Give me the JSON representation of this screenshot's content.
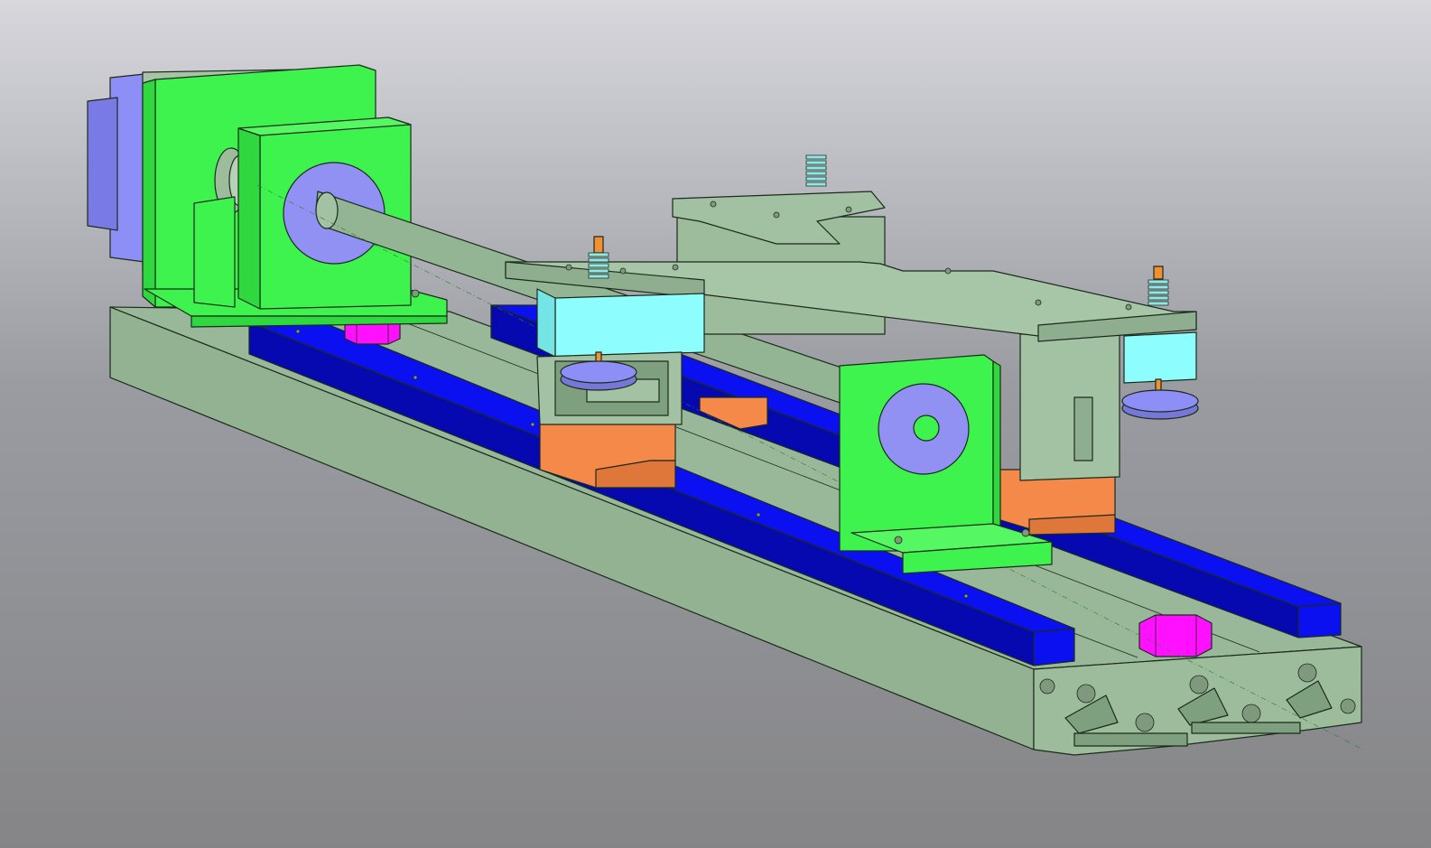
{
  "viewport": {
    "background_top": "#d7d7dc",
    "background_bottom": "#858587"
  },
  "colors": {
    "extrusion": "#99b899",
    "extrusion_dark": "#7fa07f",
    "motor_mount": "#3ff34f",
    "rail": "#0a10f0",
    "rail_dark": "#0609b0",
    "carriage_block": "#f5894a",
    "bearing_block": "#8efdfd",
    "hex_nut": "#ff10ff",
    "stepper_motor": "#8e8ef7",
    "bearing_face": "#9191f4",
    "spring": "#8fe7e7",
    "screw": "#f09030",
    "leadscrew": "#94b594",
    "outline": "#1b2a1b"
  },
  "parts": [
    "aluminum-extrusion",
    "linear-rail",
    "rail-carriage",
    "motor-mount",
    "stepper-motor",
    "bearing-block",
    "end-support",
    "leadscrew",
    "gantry-plate",
    "leveling-screw",
    "thumb-wheel",
    "hex-nut"
  ]
}
